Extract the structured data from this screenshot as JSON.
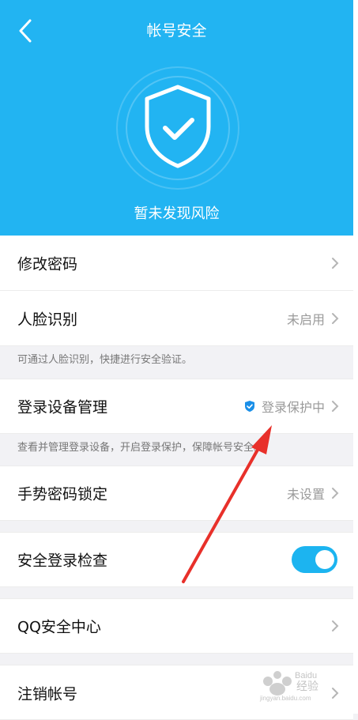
{
  "header": {
    "title": "帐号安全",
    "status_text": "暂未发现风险",
    "bg_color": "#22b4f2"
  },
  "items": [
    {
      "label": "修改密码"
    },
    {
      "label": "人脸识别",
      "value": "未启用"
    },
    {
      "label": "登录设备管理",
      "value": "登录保护中"
    },
    {
      "label": "手势密码锁定",
      "value": "未设置"
    },
    {
      "label": "安全登录检查",
      "toggle_on": true
    },
    {
      "label": "QQ安全中心"
    },
    {
      "label": "注销帐号"
    }
  ],
  "hints": {
    "face": "可通过人脸识别，快捷进行安全验证。",
    "device": "查看并管理登录设备，开启登录保护，保障帐号安全。"
  },
  "watermark": {
    "brand": "Baidu",
    "text": "经验",
    "url": "jingyan.baidu.com"
  },
  "icons": {
    "back": "chevron-left-icon",
    "shield": "shield-check-icon",
    "chevron": "chevron-right-icon",
    "small_shield": "shield-small-icon"
  }
}
